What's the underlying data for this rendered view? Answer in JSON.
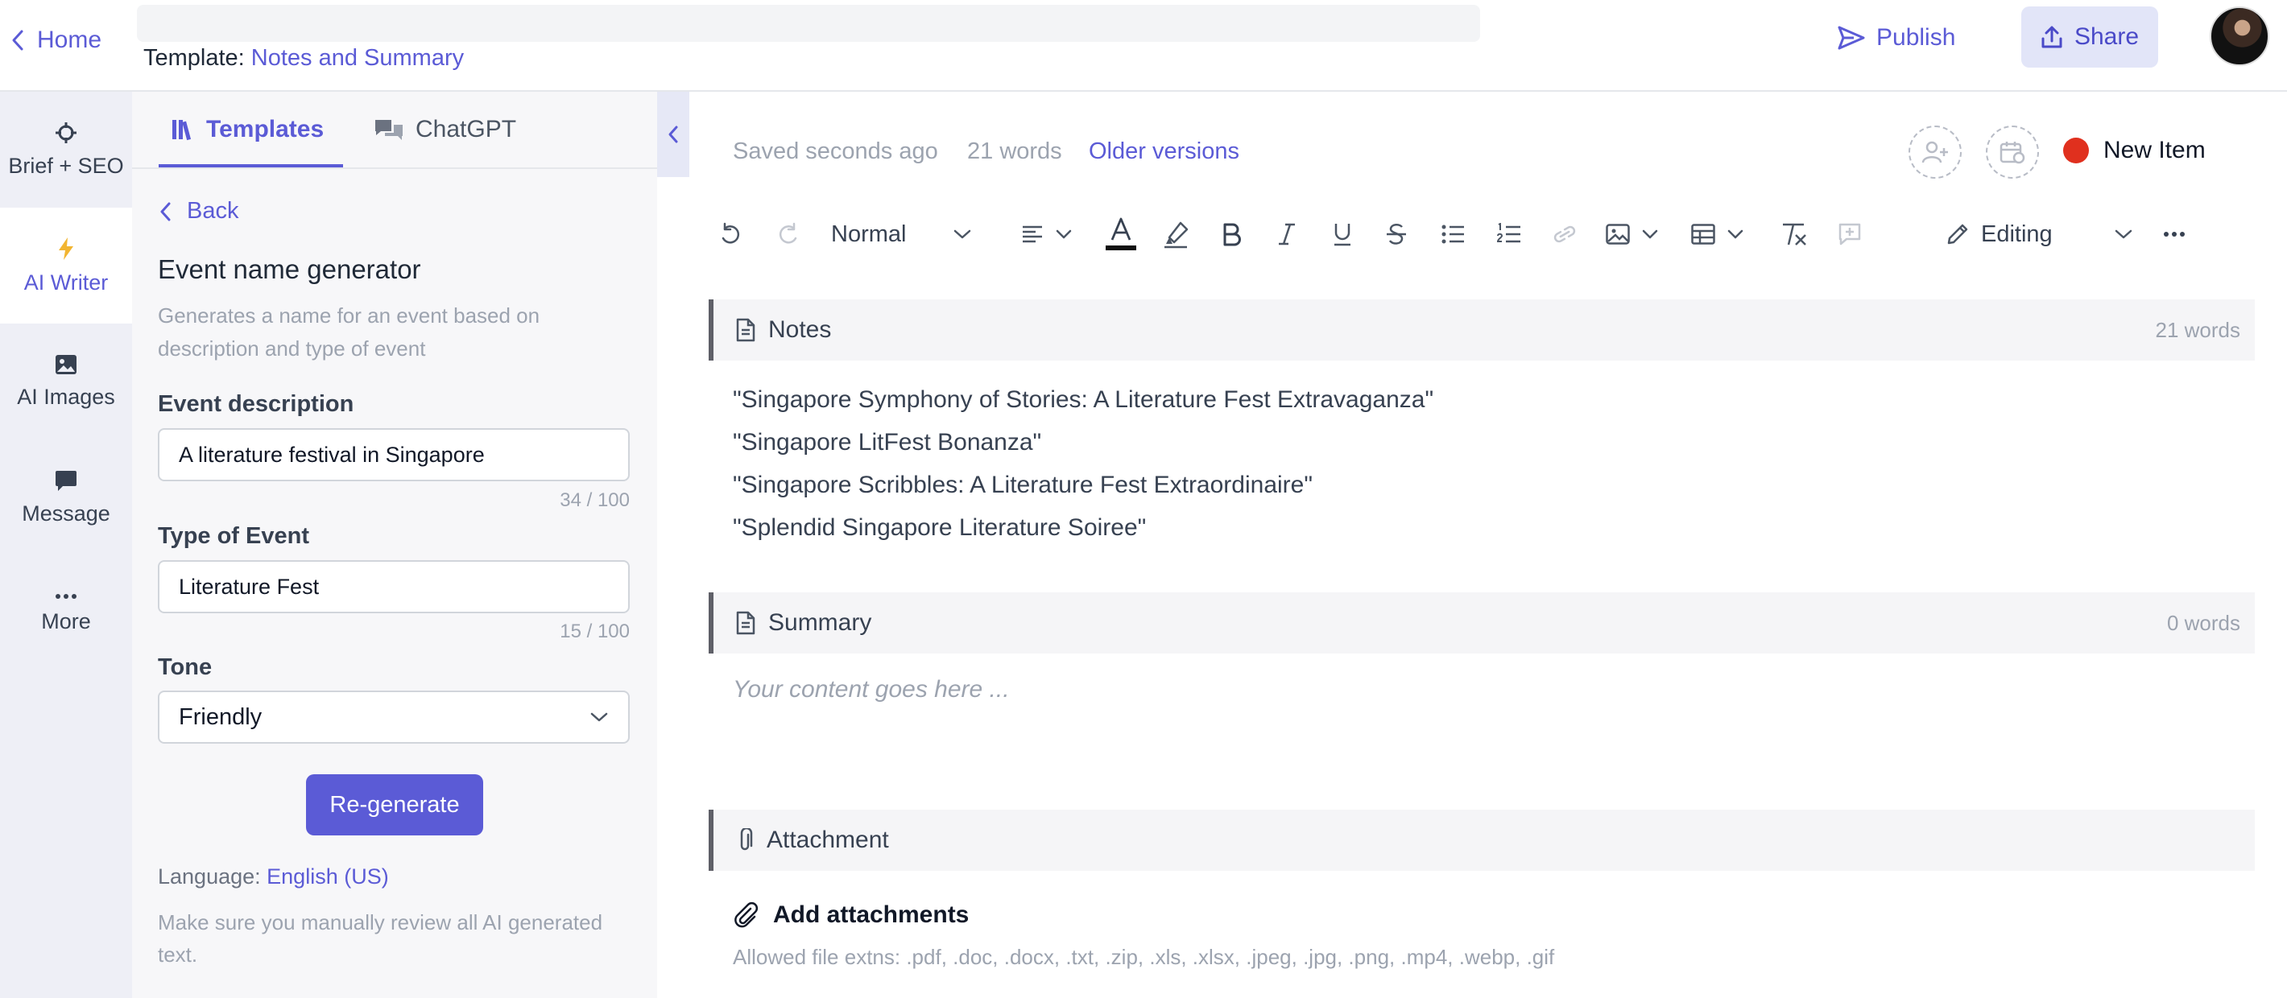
{
  "header": {
    "home_label": "Home",
    "template_prefix": "Template:",
    "template_name": "Notes and Summary",
    "publish_label": "Publish",
    "share_label": "Share"
  },
  "rail": {
    "items": [
      {
        "label": "Brief + SEO",
        "icon": "target-icon"
      },
      {
        "label": "AI Writer",
        "icon": "lightning-icon",
        "active": true
      },
      {
        "label": "AI Images",
        "icon": "image-icon"
      },
      {
        "label": "Message",
        "icon": "chat-icon"
      },
      {
        "label": "More",
        "icon": "more-dots-icon"
      }
    ]
  },
  "panel": {
    "tabs": [
      {
        "label": "Templates",
        "active": true
      },
      {
        "label": "ChatGPT"
      }
    ],
    "back_label": "Back",
    "title": "Event name generator",
    "description": "Generates a name for an event based on description and type of event",
    "fields": {
      "event_description": {
        "label": "Event description",
        "value": "A literature festival in Singapore",
        "counter": "34 / 100"
      },
      "event_type": {
        "label": "Type of Event",
        "value": "Literature Fest",
        "counter": "15 / 100"
      },
      "tone": {
        "label": "Tone",
        "value": "Friendly"
      }
    },
    "regenerate_label": "Re-generate",
    "language_prefix": "Language:",
    "language_value": "English (US)",
    "review_note": "Make sure you manually review all AI generated text."
  },
  "editor": {
    "saved_status": "Saved seconds ago",
    "word_count": "21 words",
    "older_versions": "Older versions",
    "status_label": "New Item",
    "status_color": "#e0301e",
    "text_style": "Normal",
    "mode_label": "Editing",
    "notes": {
      "title": "Notes",
      "count": "21 words",
      "lines": [
        "\"Singapore Symphony of Stories: A Literature Fest Extravaganza\"",
        "\"Singapore LitFest Bonanza\"",
        "\"Singapore Scribbles: A Literature Fest Extraordinaire\"",
        "\"Splendid Singapore Literature Soiree\""
      ]
    },
    "summary": {
      "title": "Summary",
      "count": "0 words",
      "placeholder": "Your content goes here ..."
    },
    "attachment": {
      "title": "Attachment",
      "add_label": "Add attachments",
      "allowed": "Allowed file extns: .pdf, .doc, .docx, .txt, .zip, .xls, .xlsx, .jpeg, .jpg, .png, .mp4, .webp, .gif"
    }
  },
  "colors": {
    "accent": "#5b5bd6",
    "share_bg": "#e2e5f8",
    "rail_bg": "#eeeff6"
  }
}
